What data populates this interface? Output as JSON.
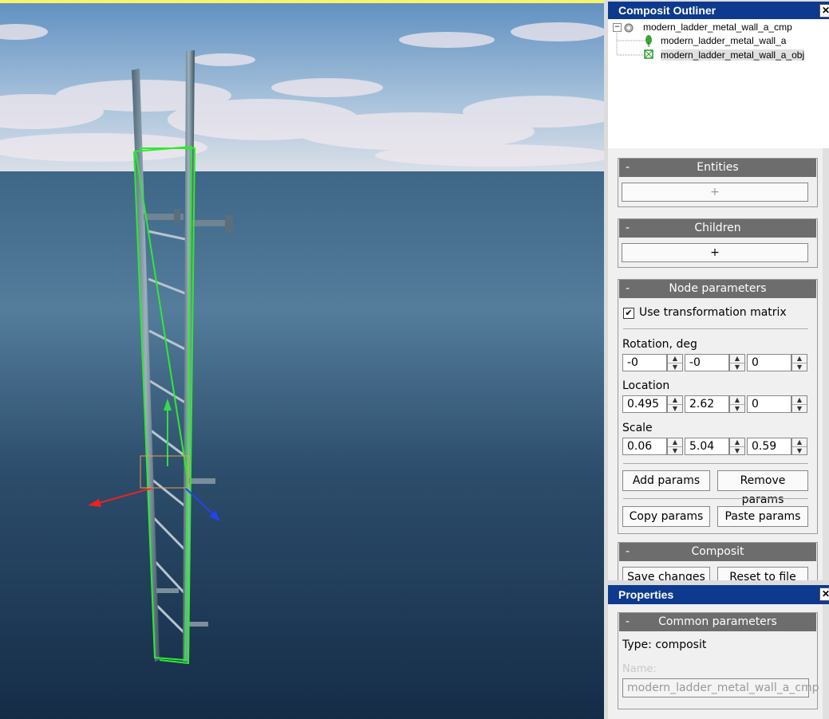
{
  "outliner": {
    "title": "Composit Outliner",
    "close": "✕",
    "root": "modern_ladder_metal_wall_a_cmp",
    "children": [
      "modern_ladder_metal_wall_a",
      "modern_ladder_metal_wall_a_obj"
    ],
    "expander": "−"
  },
  "entities": {
    "title": "Entities",
    "collapse": "-",
    "add": "+"
  },
  "children_group": {
    "title": "Children",
    "collapse": "-",
    "add": "+"
  },
  "node_params": {
    "title": "Node parameters",
    "collapse": "-",
    "use_matrix_label": "Use transformation matrix",
    "use_matrix_checked": true,
    "check_glyph": "✔",
    "rotation_label": "Rotation, deg",
    "rotation": [
      "-0",
      "-0",
      "0"
    ],
    "location_label": "Location",
    "location": [
      "0.495",
      "2.62",
      "0"
    ],
    "scale_label": "Scale",
    "scale": [
      "0.06",
      "5.04",
      "0.59"
    ],
    "add_params": "Add params",
    "remove_params": "Remove params",
    "copy_params": "Copy params",
    "paste_params": "Paste params"
  },
  "composit": {
    "title": "Composit",
    "collapse": "-",
    "save": "Save changes",
    "reset": "Reset to file"
  },
  "properties": {
    "title": "Properties",
    "close": "✕",
    "common_title": "Common parameters",
    "collapse": "-",
    "type_label": "Type: composit",
    "name_label": "Name:",
    "name_value": "modern_ladder_metal_wall_a_cmp"
  },
  "spin_up": "▲",
  "spin_down": "▼"
}
